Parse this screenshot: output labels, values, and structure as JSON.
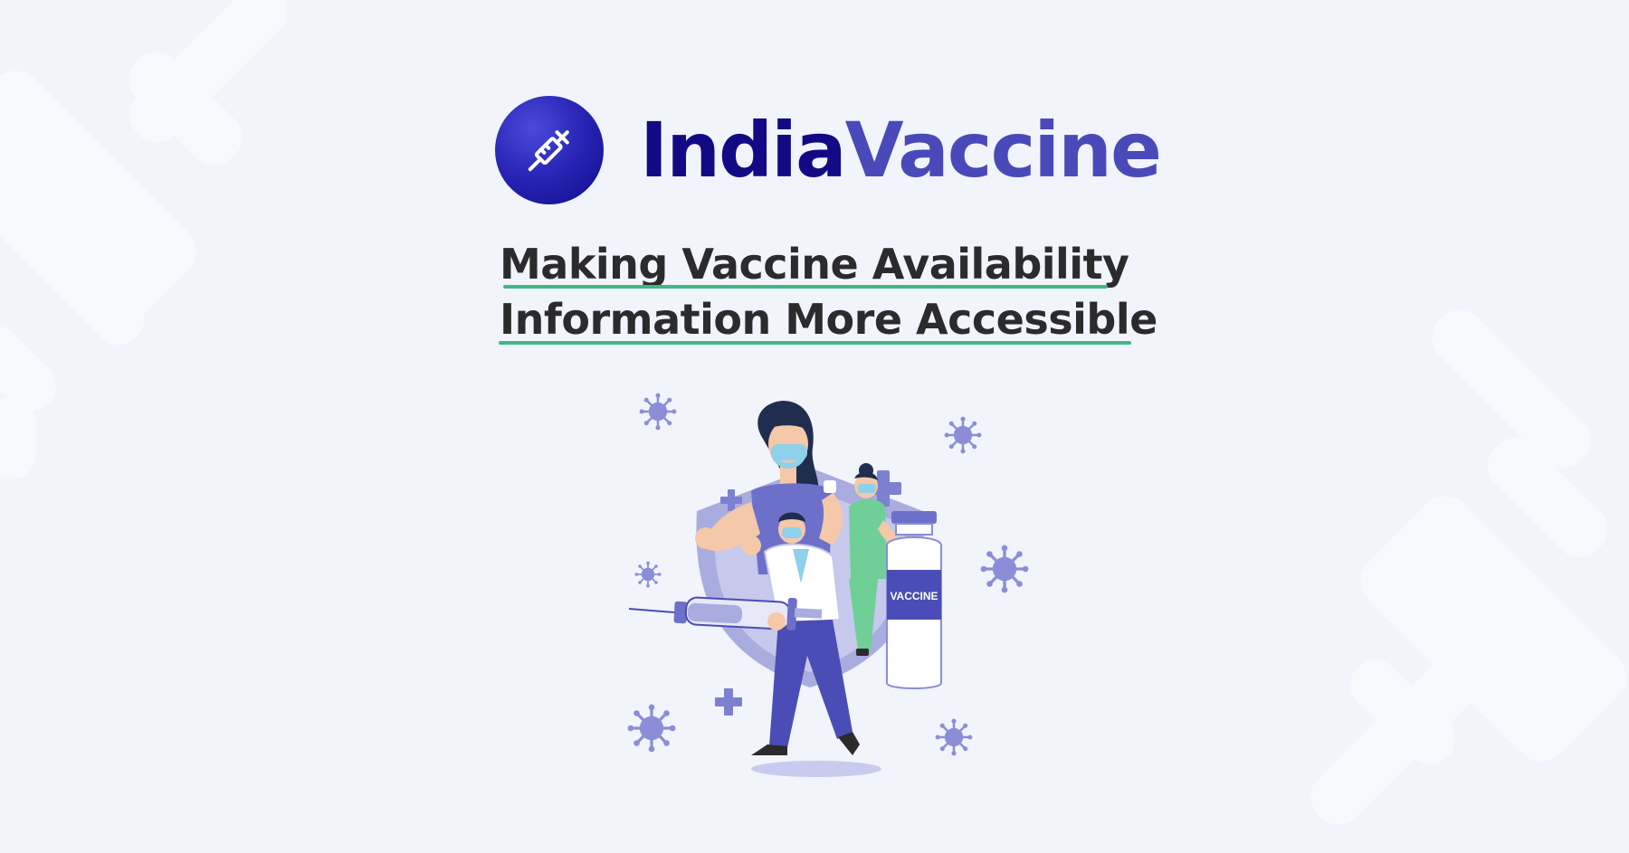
{
  "brand": {
    "name_part1": "India",
    "name_part2": "Vaccine",
    "logo_icon": "syringe-icon",
    "colors": {
      "name_part1": "#120a85",
      "name_part2": "#4a49b9",
      "logo_bg": "#2a27b8"
    }
  },
  "tagline": {
    "line1": "Making Vaccine Availability",
    "line2": "Information More Accessible",
    "underline_color": "#3fb884"
  },
  "illustration": {
    "vial_label": "VACCINE",
    "icons": [
      "virus-icon",
      "plus-icon",
      "shield-icon",
      "syringe-icon",
      "vaccine-vial-icon"
    ]
  }
}
